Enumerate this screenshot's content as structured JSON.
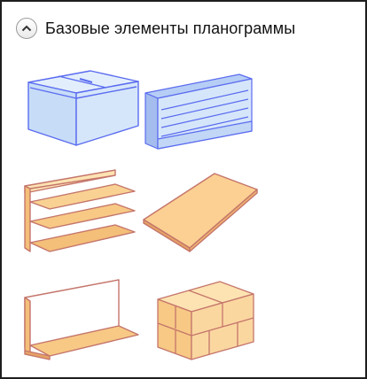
{
  "section": {
    "title": "Базовые элементы планограммы",
    "toggle_icon": "chevron-up-icon"
  },
  "elements": [
    {
      "name": "freezer",
      "icon": "chest-freezer-icon"
    },
    {
      "name": "refrigerated-shelving",
      "icon": "refrigerated-shelving-icon"
    },
    {
      "name": "wall-shelving",
      "icon": "wall-shelving-icon"
    },
    {
      "name": "platform",
      "icon": "flat-platform-icon"
    },
    {
      "name": "single-shelf-wall",
      "icon": "single-shelf-wall-icon"
    },
    {
      "name": "box-stack",
      "icon": "box-stack-icon"
    }
  ],
  "colors": {
    "cold_stroke": "#5a6cf0",
    "cold_fill": "#c7dcf7",
    "warm_stroke": "#c4756b",
    "warm_fill_light": "#fde3b2",
    "warm_fill_dark": "#f4bf78"
  }
}
